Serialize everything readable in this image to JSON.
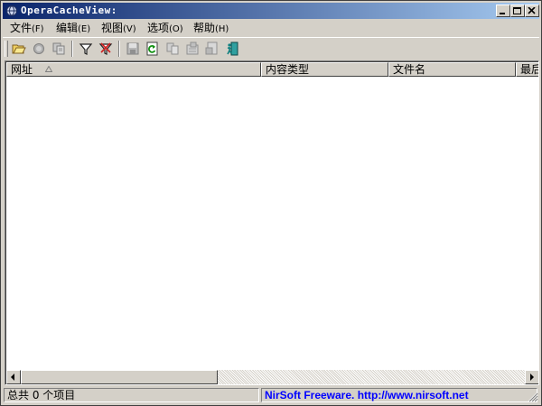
{
  "window": {
    "title": "OperaCacheView:",
    "controls": [
      "minimize-icon",
      "maximize-icon",
      "close-icon"
    ]
  },
  "menu": {
    "items": [
      {
        "label": "文件",
        "accel": "(F)"
      },
      {
        "label": "编辑",
        "accel": "(E)"
      },
      {
        "label": "视图",
        "accel": "(V)"
      },
      {
        "label": "选项",
        "accel": "(O)"
      },
      {
        "label": "帮助",
        "accel": "(H)"
      }
    ]
  },
  "toolbar": {
    "buttons": [
      {
        "icon": "open-folder-icon",
        "enabled": true
      },
      {
        "icon": "stop-icon",
        "enabled": false
      },
      {
        "icon": "copy-url-icon",
        "enabled": false
      },
      {
        "icon": "filter-icon",
        "enabled": true
      },
      {
        "icon": "clear-filter-icon",
        "enabled": true
      },
      {
        "icon": "save-icon",
        "enabled": false
      },
      {
        "icon": "refresh-icon",
        "enabled": true
      },
      {
        "icon": "copy-icon",
        "enabled": false
      },
      {
        "icon": "properties-icon",
        "enabled": false
      },
      {
        "icon": "html-report-icon",
        "enabled": false
      },
      {
        "icon": "exit-icon",
        "enabled": true
      }
    ]
  },
  "list": {
    "columns": [
      {
        "label": "网址",
        "sorted": true
      },
      {
        "label": "内容类型"
      },
      {
        "label": "文件名"
      },
      {
        "label": "最后"
      }
    ],
    "rows": []
  },
  "status": {
    "count_text": "总共 0 个项目",
    "link_text": "NirSoft Freeware.  http://www.nirsoft.net"
  },
  "colors": {
    "titlebar_start": "#0a246a",
    "titlebar_end": "#a6caf0",
    "face": "#d4d0c8",
    "link": "#0000ff"
  }
}
